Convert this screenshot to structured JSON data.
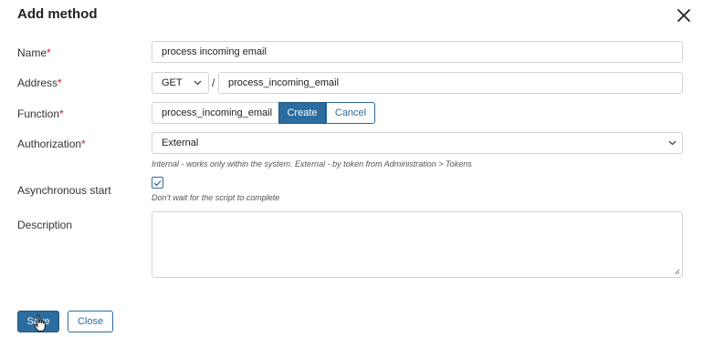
{
  "dialog": {
    "title": "Add method",
    "close_icon": "close-icon"
  },
  "form": {
    "name": {
      "label": "Name",
      "required_mark": "*",
      "value": "process incoming email"
    },
    "address": {
      "label": "Address",
      "required_mark": "*",
      "method_value": "GET",
      "separator": "/",
      "path_value": "process_incoming_email"
    },
    "function": {
      "label": "Function",
      "required_mark": "*",
      "value": "process_incoming_email",
      "create_label": "Create",
      "cancel_label": "Cancel"
    },
    "authorization": {
      "label": "Authorization",
      "required_mark": "*",
      "value": "External",
      "hint": "Internal - works only within the system. External - by token from Administration > Tokens"
    },
    "async": {
      "label": "Asynchronous start",
      "checked": true,
      "hint": "Don't wait for the script to complete"
    },
    "description": {
      "label": "Description",
      "value": ""
    }
  },
  "footer": {
    "save_label": "Save",
    "close_label": "Close"
  },
  "colors": {
    "primary": "#2c6c9e",
    "required": "#d0102a",
    "border": "#cfd4d9"
  }
}
